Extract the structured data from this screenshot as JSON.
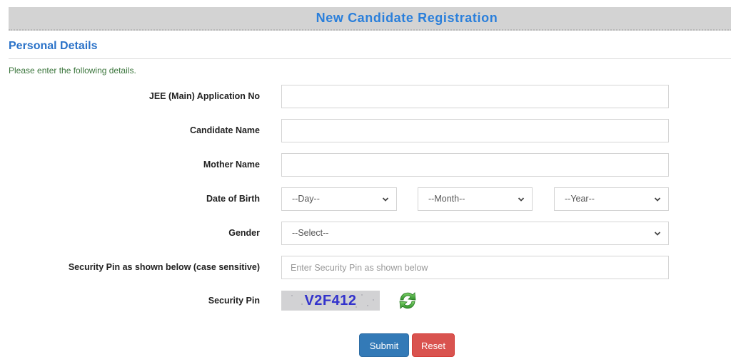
{
  "header": {
    "title": "New Candidate Registration"
  },
  "section": {
    "title": "Personal Details",
    "intro": "Please enter the following details."
  },
  "form": {
    "application_no": {
      "label": "JEE (Main) Application No",
      "value": "",
      "placeholder": ""
    },
    "candidate_name": {
      "label": "Candidate Name",
      "value": "",
      "placeholder": ""
    },
    "mother_name": {
      "label": "Mother Name",
      "value": "",
      "placeholder": ""
    },
    "dob": {
      "label": "Date of Birth",
      "day": "--Day--",
      "month": "--Month--",
      "year": "--Year--"
    },
    "gender": {
      "label": "Gender",
      "selected": "--Select--"
    },
    "security_pin_input": {
      "label": "Security Pin as shown below (case sensitive)",
      "value": "",
      "placeholder": "Enter Security Pin as shown below"
    },
    "security_pin": {
      "label": "Security Pin",
      "captcha_text": "V2F412",
      "refresh_icon": "refresh-icon"
    }
  },
  "buttons": {
    "submit": "Submit",
    "reset": "Reset"
  },
  "colors": {
    "title": "#2a7fdb",
    "section_title": "#2a72c8",
    "intro_text": "#3c763d",
    "submit": "#337ab7",
    "reset": "#d9534f",
    "captcha_text": "#3333cc",
    "refresh_icon": "#3fa535"
  }
}
